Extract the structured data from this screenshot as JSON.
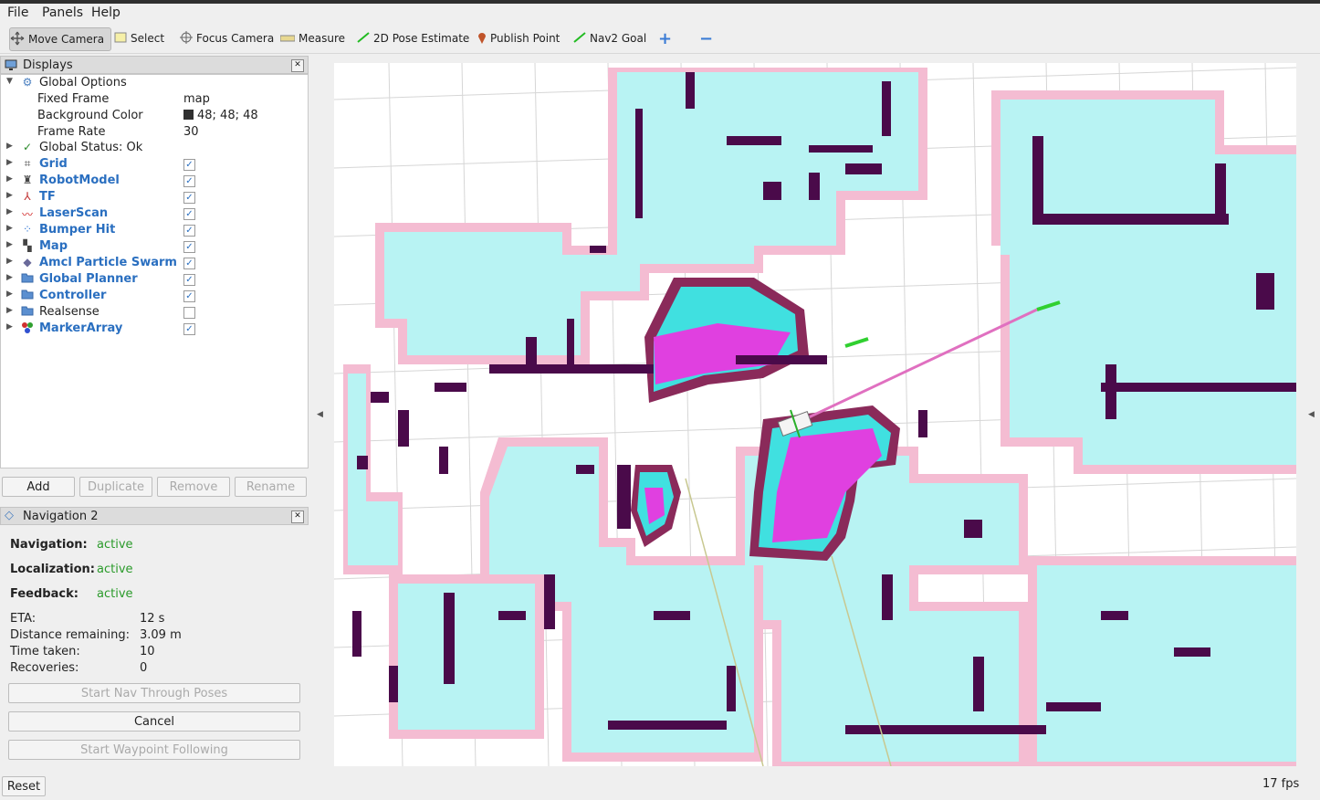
{
  "menu": {
    "file": "File",
    "panels": "Panels",
    "help": "Help"
  },
  "toolbar": {
    "move_camera": "Move Camera",
    "select": "Select",
    "focus_camera": "Focus Camera",
    "measure": "Measure",
    "pose_estimate": "2D Pose Estimate",
    "publish_point": "Publish Point",
    "nav2_goal": "Nav2 Goal"
  },
  "displays": {
    "title": "Displays",
    "global_options": "Global Options",
    "fixed_frame_label": "Fixed Frame",
    "fixed_frame_value": "map",
    "bg_color_label": "Background Color",
    "bg_color_value": "48; 48; 48",
    "frame_rate_label": "Frame Rate",
    "frame_rate_value": "30",
    "global_status": "Global Status: Ok",
    "items": [
      {
        "label": "Grid",
        "checked": true
      },
      {
        "label": "RobotModel",
        "checked": true
      },
      {
        "label": "TF",
        "checked": true
      },
      {
        "label": "LaserScan",
        "checked": true
      },
      {
        "label": "Bumper Hit",
        "checked": true
      },
      {
        "label": "Map",
        "checked": true
      },
      {
        "label": "Amcl Particle Swarm",
        "checked": true
      },
      {
        "label": "Global Planner",
        "checked": true
      },
      {
        "label": "Controller",
        "checked": true
      },
      {
        "label": "Realsense",
        "checked": false
      },
      {
        "label": "MarkerArray",
        "checked": true
      }
    ],
    "buttons": {
      "add": "Add",
      "duplicate": "Duplicate",
      "remove": "Remove",
      "rename": "Rename"
    }
  },
  "navigation": {
    "title": "Navigation 2",
    "navigation_label": "Navigation:",
    "navigation_value": "active",
    "localization_label": "Localization:",
    "localization_value": "active",
    "feedback_label": "Feedback:",
    "feedback_value": "active",
    "eta_label": "ETA:",
    "eta_value": "12 s",
    "distance_label": "Distance remaining:",
    "distance_value": "3.09 m",
    "time_label": "Time taken:",
    "time_value": "10",
    "recoveries_label": "Recoveries:",
    "recoveries_value": "0",
    "start_nav_through_poses": "Start Nav Through Poses",
    "cancel": "Cancel",
    "start_waypoint_following": "Start Waypoint Following"
  },
  "status": {
    "reset": "Reset",
    "fps": "17 fps"
  },
  "colors": {
    "costmap_cyan": "#b8f3f3",
    "inflation_pink": "#f2a8c8",
    "obstacle": "#4a0a4a",
    "lethal_magenta": "#e040e0",
    "lethal_cyan": "#40e8e8",
    "active_green": "#2a9a2a"
  }
}
